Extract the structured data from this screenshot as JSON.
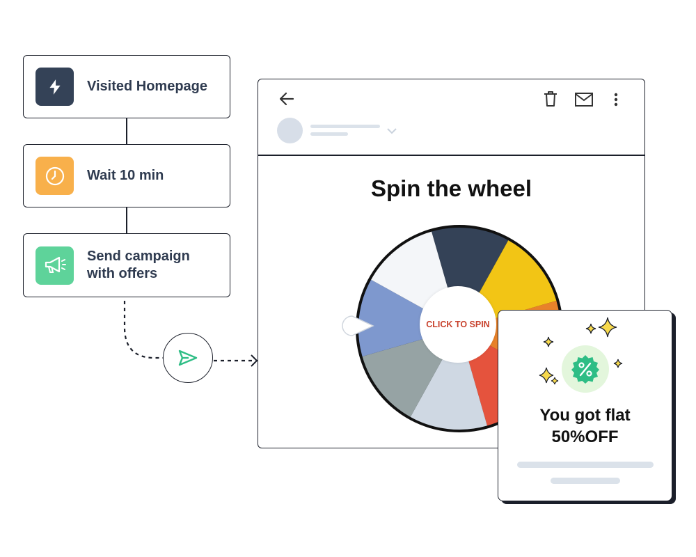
{
  "workflow": {
    "steps": [
      {
        "label": "Visited Homepage",
        "icon": "lightning-icon",
        "color": "#344257"
      },
      {
        "label": "Wait 10 min",
        "icon": "clock-icon",
        "color": "#F8B04B"
      },
      {
        "label": "Send campaign\nwith offers",
        "icon": "megaphone-icon",
        "color": "#5ED39A"
      }
    ],
    "send_icon": "send-icon"
  },
  "email": {
    "toolbar_icons": [
      "back-arrow-icon",
      "trash-icon",
      "mail-icon",
      "more-vertical-icon"
    ],
    "title": "Spin the wheel",
    "wheel": {
      "center_label": "CLICK TO SPIN",
      "segment_colors": [
        "#344257",
        "#F2C515",
        "#E8822A",
        "#E5533D",
        "#CFD8E3",
        "#96A3A4",
        "#7E98CE",
        "#F4F6F9"
      ]
    }
  },
  "popup": {
    "message": "You got flat\n50%OFF",
    "badge_icon": "percent-badge-icon",
    "badge_color": "#2EBD85"
  }
}
